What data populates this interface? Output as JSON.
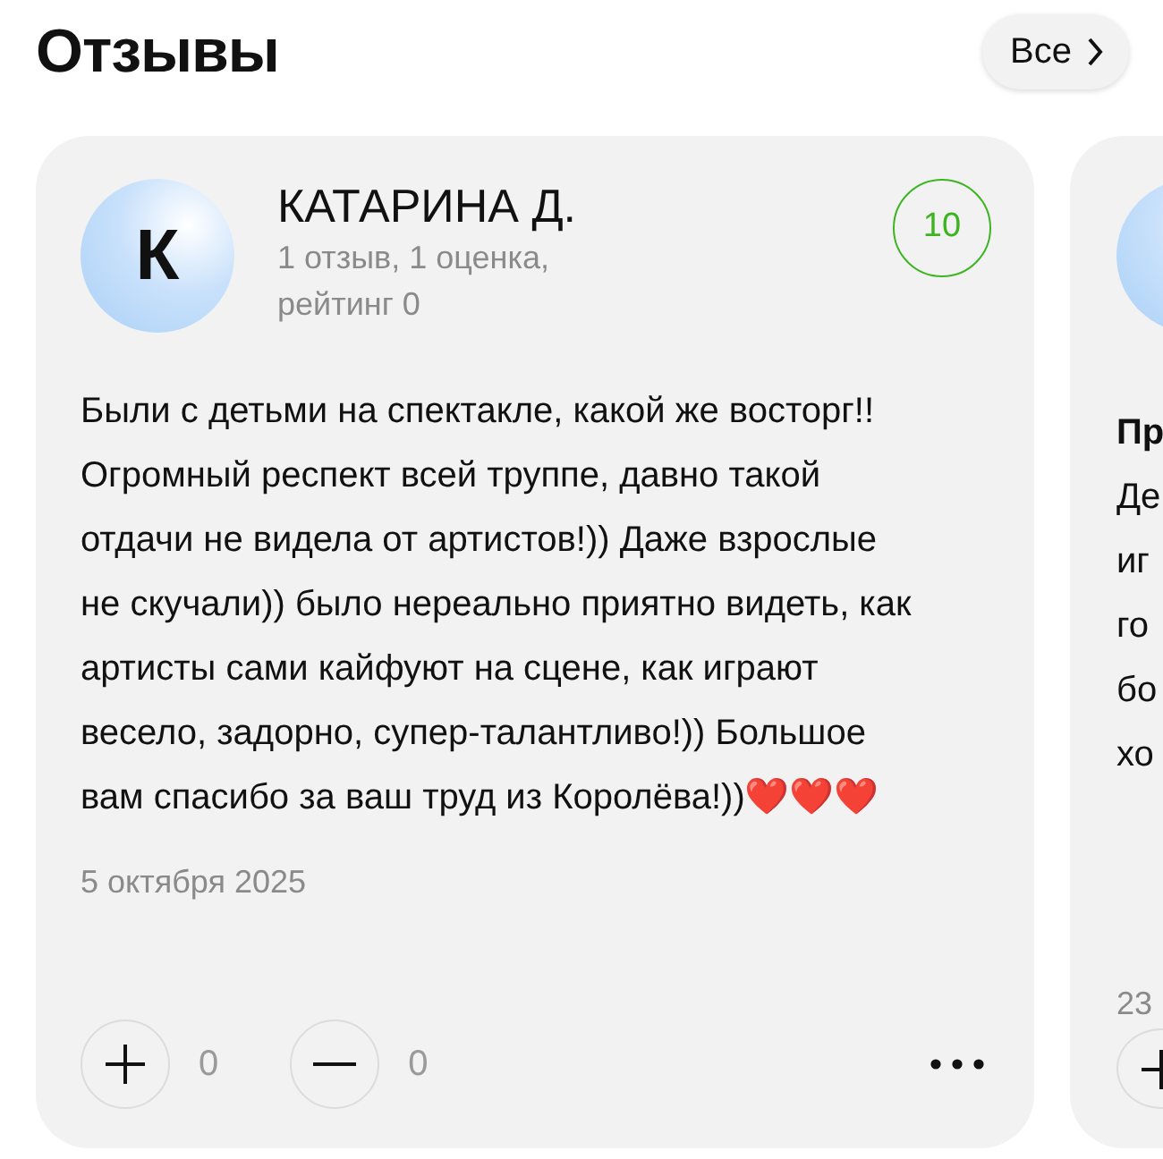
{
  "header": {
    "title": "Отзывы",
    "all_button": "Все"
  },
  "reviews": [
    {
      "avatar_letter": "К",
      "author": "КАТАРИНА Д.",
      "stats": "1 отзыв, 1 оценка,\nрейтинг 0",
      "score": "10",
      "text_lines": [
        "Были с детьми на спектакле, какой же восторг!! Огромный респект всей труппе, давно такой отдачи не видела от артистов!)) Даже взрослые не скучали)) было нереально приятно видеть, как артисты сами кайфуют на сцене, как играют весело, задорно, супер-талантливо!)) Большое вам спасибо за ваш труд из Королёва!))❤️❤️❤️"
      ],
      "date": "5 октября 2025",
      "likes": "0",
      "dislikes": "0"
    },
    {
      "text_lines": [
        "Пр",
        "Де",
        "иг",
        "го",
        "бо",
        "хо"
      ],
      "date": "23"
    }
  ]
}
